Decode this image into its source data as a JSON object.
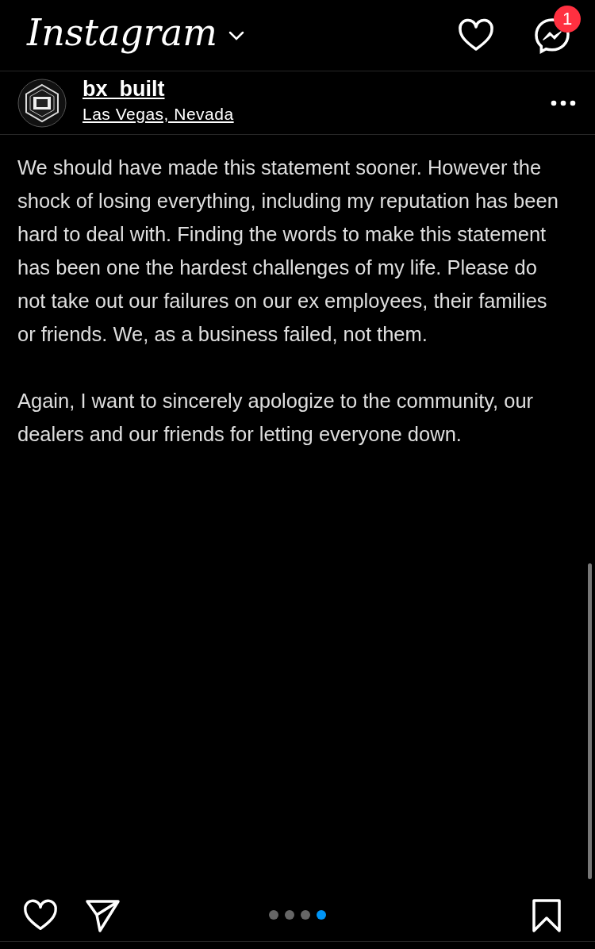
{
  "app_bar": {
    "logo": "Instagram",
    "notification_badge": "1"
  },
  "post": {
    "username": "bx_built",
    "location": "Las Vegas, Nevada",
    "slide_paragraphs": [
      "We should have made this statement sooner. However the shock of losing everything, including my reputation has been hard to deal with. Finding the words to make this statement has been one the hardest challenges of my life. Please do not take out our failures on our ex employees, their families or friends. We, as a business failed, not them.",
      "Again, I want to sincerely apologize to the community, our dealers and our friends for letting everyone down."
    ],
    "carousel_dots": [
      {
        "selected": false
      },
      {
        "selected": false
      },
      {
        "selected": false
      },
      {
        "selected": true
      }
    ]
  }
}
